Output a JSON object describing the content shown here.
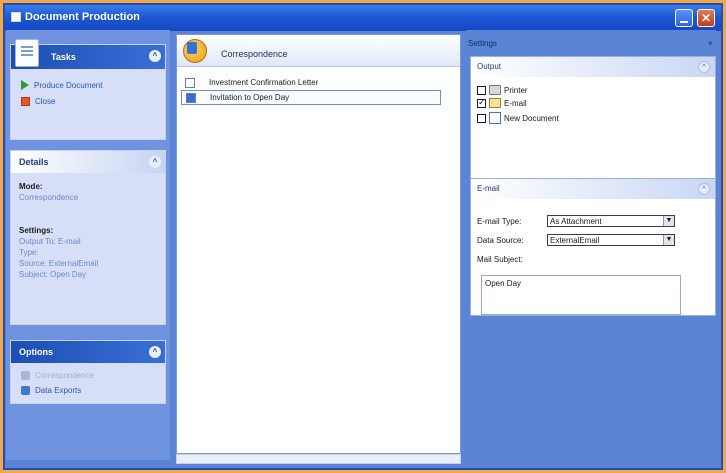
{
  "window": {
    "title": "Document Production",
    "close_glyph": "✕"
  },
  "left": {
    "tasks": {
      "header": "Tasks",
      "items": [
        {
          "label": "Produce Document",
          "icon": "play-icon"
        },
        {
          "label": "Close",
          "icon": "close-icon"
        }
      ]
    },
    "details": {
      "header": "Details",
      "mode_label": "Mode:",
      "mode_value": "Correspondence",
      "settings_label": "Settings:",
      "settings_lines": [
        "Output To: E-mail",
        "Type:",
        "Source: ExternalEmail",
        "Subject: Open Day"
      ]
    },
    "options": {
      "header": "Options",
      "items": [
        {
          "label": "Correspondence",
          "enabled": false
        },
        {
          "label": "Data Exports",
          "enabled": true
        }
      ]
    }
  },
  "middle": {
    "title": "Correspondence",
    "documents": [
      {
        "label": "Investment Confirmation Letter",
        "selected": false
      },
      {
        "label": "Invitation to Open Day",
        "selected": true
      }
    ]
  },
  "right": {
    "settings_label": "Settings",
    "output": {
      "header": "Output",
      "options": [
        {
          "label": "Printer",
          "checked": false,
          "icon": "printer-icon"
        },
        {
          "label": "E-mail",
          "checked": true,
          "icon": "mail-icon"
        },
        {
          "label": "New Document",
          "checked": false,
          "icon": "new-document-icon"
        }
      ]
    },
    "email": {
      "header": "E-mail",
      "email_type_label": "E-mail Type:",
      "email_type_value": "As Attachment",
      "data_source_label": "Data Source:",
      "data_source_value": "ExternalEmail",
      "mail_subject_label": "Mail Subject:",
      "mail_subject_value": "Open Day"
    }
  },
  "colors": {
    "accent": "#1a56d2",
    "pane_blue": "#5b84d4",
    "frame_orange": "#f3a64a"
  }
}
